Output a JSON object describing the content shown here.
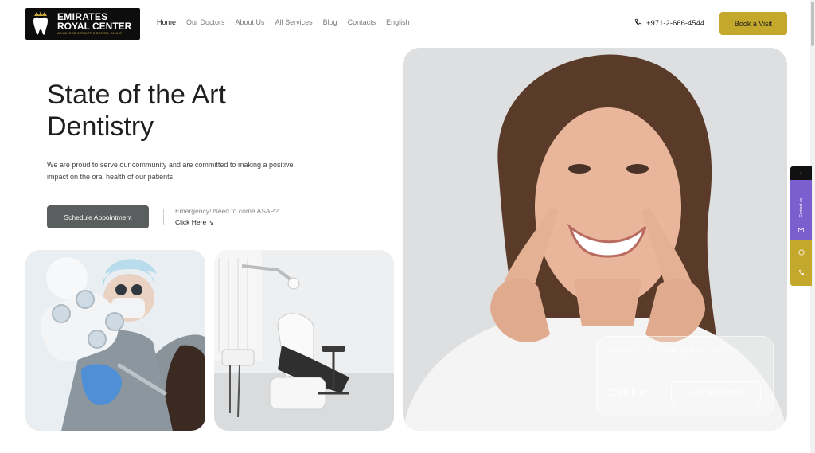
{
  "brand": {
    "line1": "EMIRATES",
    "line2": "ROYAL CENTER",
    "tagline": "ADVANCED COSMETIC DENTAL CLINIC"
  },
  "nav": {
    "items": [
      "Home",
      "Our Doctors",
      "About Us",
      "All Services",
      "Blog",
      "Contacts",
      "English"
    ]
  },
  "header": {
    "phone": "+971-2-666-4544",
    "book_label": "Book a Visit"
  },
  "hero": {
    "title": "State of the Art Dentistry",
    "subtitle": "We are proud to serve our community and are committed to making a positive impact on the oral health of our patients.",
    "schedule_label": "Schedule Appointment",
    "emergency_text": "Emergency! Need to come ASAP?",
    "click_here": "Click Here ↘"
  },
  "overlay": {
    "top_text": "PRIORITIZE YOUR DENTAL HEALTH",
    "call_label": "Call Us:",
    "call_number": "+971 58 809 0880"
  },
  "side_widget": {
    "toggle": "›",
    "contact_label": "Contact us",
    "icons": [
      "email-icon",
      "whatsapp-icon",
      "phone-icon"
    ]
  },
  "colors": {
    "accent": "#c4a82c",
    "dark_button": "#5b5e5e",
    "widget_purple": "#7b5fcf"
  }
}
